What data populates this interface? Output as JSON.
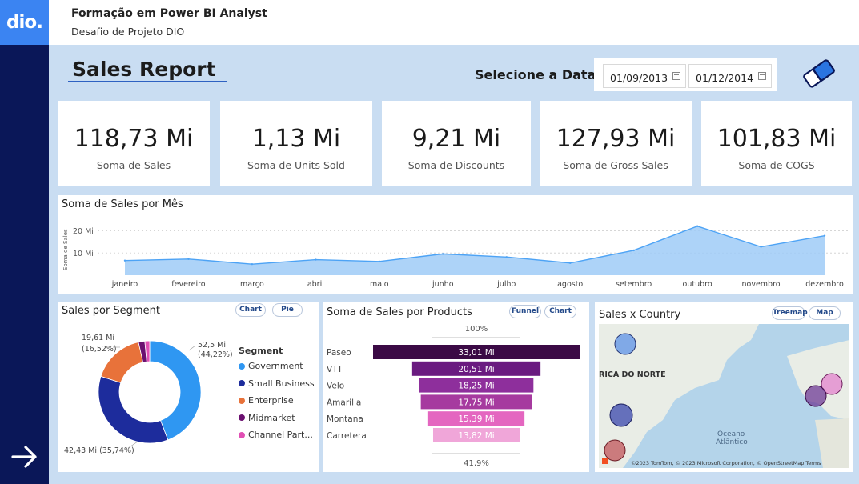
{
  "header": {
    "logo_text": "dio.",
    "title": "Formação em Power BI Analyst",
    "subtitle": "Desafio de Projeto DIO"
  },
  "report": {
    "title": "Sales Report",
    "date_label": "Selecione a Data",
    "date_start": "01/09/2013",
    "date_end": "01/12/2014"
  },
  "kpis": [
    {
      "value": "118,73 Mi",
      "label": "Soma de  Sales"
    },
    {
      "value": "1,13 Mi",
      "label": "Soma de Units Sold"
    },
    {
      "value": "9,21 Mi",
      "label": "Soma de Discounts"
    },
    {
      "value": "127,93 Mi",
      "label": "Soma de Gross Sales"
    },
    {
      "value": "101,83 Mi",
      "label": "Soma de COGS"
    }
  ],
  "line_card": {
    "title": "Soma de Sales por Mês"
  },
  "segment_card": {
    "title": "Sales por Segment",
    "pill_1": "Chart",
    "pill_2": "Pie",
    "legend_title": "Segment",
    "label_government": "52,5 Mi",
    "label_government_pct": "(44,22%)",
    "label_small": "42,43 Mi (35,74%)",
    "label_enterprise": "19,61 Mi",
    "label_enterprise_pct": "(16,52%)"
  },
  "products_card": {
    "title": "Soma de Sales por Products",
    "pill_1": "Funnel",
    "pill_2": "Chart",
    "top_pct": "100%",
    "bottom_pct": "41,9%"
  },
  "country_card": {
    "title": "Sales x Country",
    "pill_1": "Treemap",
    "pill_2": "Map",
    "map_label_1": "RICA DO NORTE",
    "map_label_2": "Oceano",
    "map_label_3": "Atlântico",
    "attribution": "©2023 TomTom, © 2023 Microsoft Corporation, © OpenStreetMap  Terms"
  },
  "colors": {
    "rail": "#0a1758",
    "logo": "#3b84f2",
    "canvas": "#c9ddf2",
    "line_fill": "#9fcbf7",
    "line_stroke": "#4da3f5"
  },
  "chart_data": [
    {
      "type": "area",
      "title": "Soma de Sales por Mês",
      "ylabel": "Soma de Sales",
      "y_tick_labels": [
        "20 Mi",
        "10 Mi"
      ],
      "y_ticks": [
        20,
        10
      ],
      "ylim": [
        0,
        25
      ],
      "grid": true,
      "categories": [
        "janeiro",
        "fevereiro",
        "março",
        "abril",
        "maio",
        "junho",
        "julho",
        "agosto",
        "setembro",
        "outubro",
        "novembro",
        "dezembro"
      ],
      "values": [
        6.6,
        7.3,
        5.0,
        7.0,
        6.2,
        9.6,
        8.2,
        5.5,
        11.2,
        22.1,
        12.8,
        17.8
      ]
    },
    {
      "type": "pie",
      "title": "Sales por Segment",
      "donut": true,
      "categories": [
        "Government",
        "Small Business",
        "Enterprise",
        "Midmarket",
        "Channel Part..."
      ],
      "values": [
        52.5,
        42.43,
        19.61,
        2.38,
        1.81
      ],
      "colors": [
        "#2f97f2",
        "#1d2c9c",
        "#e8723a",
        "#6b1070",
        "#e14fb4"
      ]
    },
    {
      "type": "bar",
      "subtype": "funnel",
      "title": "Soma de Sales por Products",
      "categories": [
        "Paseo",
        "VTT",
        "Velo",
        "Amarilla",
        "Montana",
        "Carretera"
      ],
      "values": [
        33.01,
        20.51,
        18.25,
        17.75,
        15.39,
        13.82
      ],
      "value_labels": [
        "33,01 Mi",
        "20,51 Mi",
        "18,25 Mi",
        "17,75 Mi",
        "15,39 Mi",
        "13,82 Mi"
      ],
      "colors": [
        "#3b0a45",
        "#6a1b80",
        "#8e2f9c",
        "#a63a9f",
        "#e466c0",
        "#f0a6d9"
      ]
    }
  ]
}
